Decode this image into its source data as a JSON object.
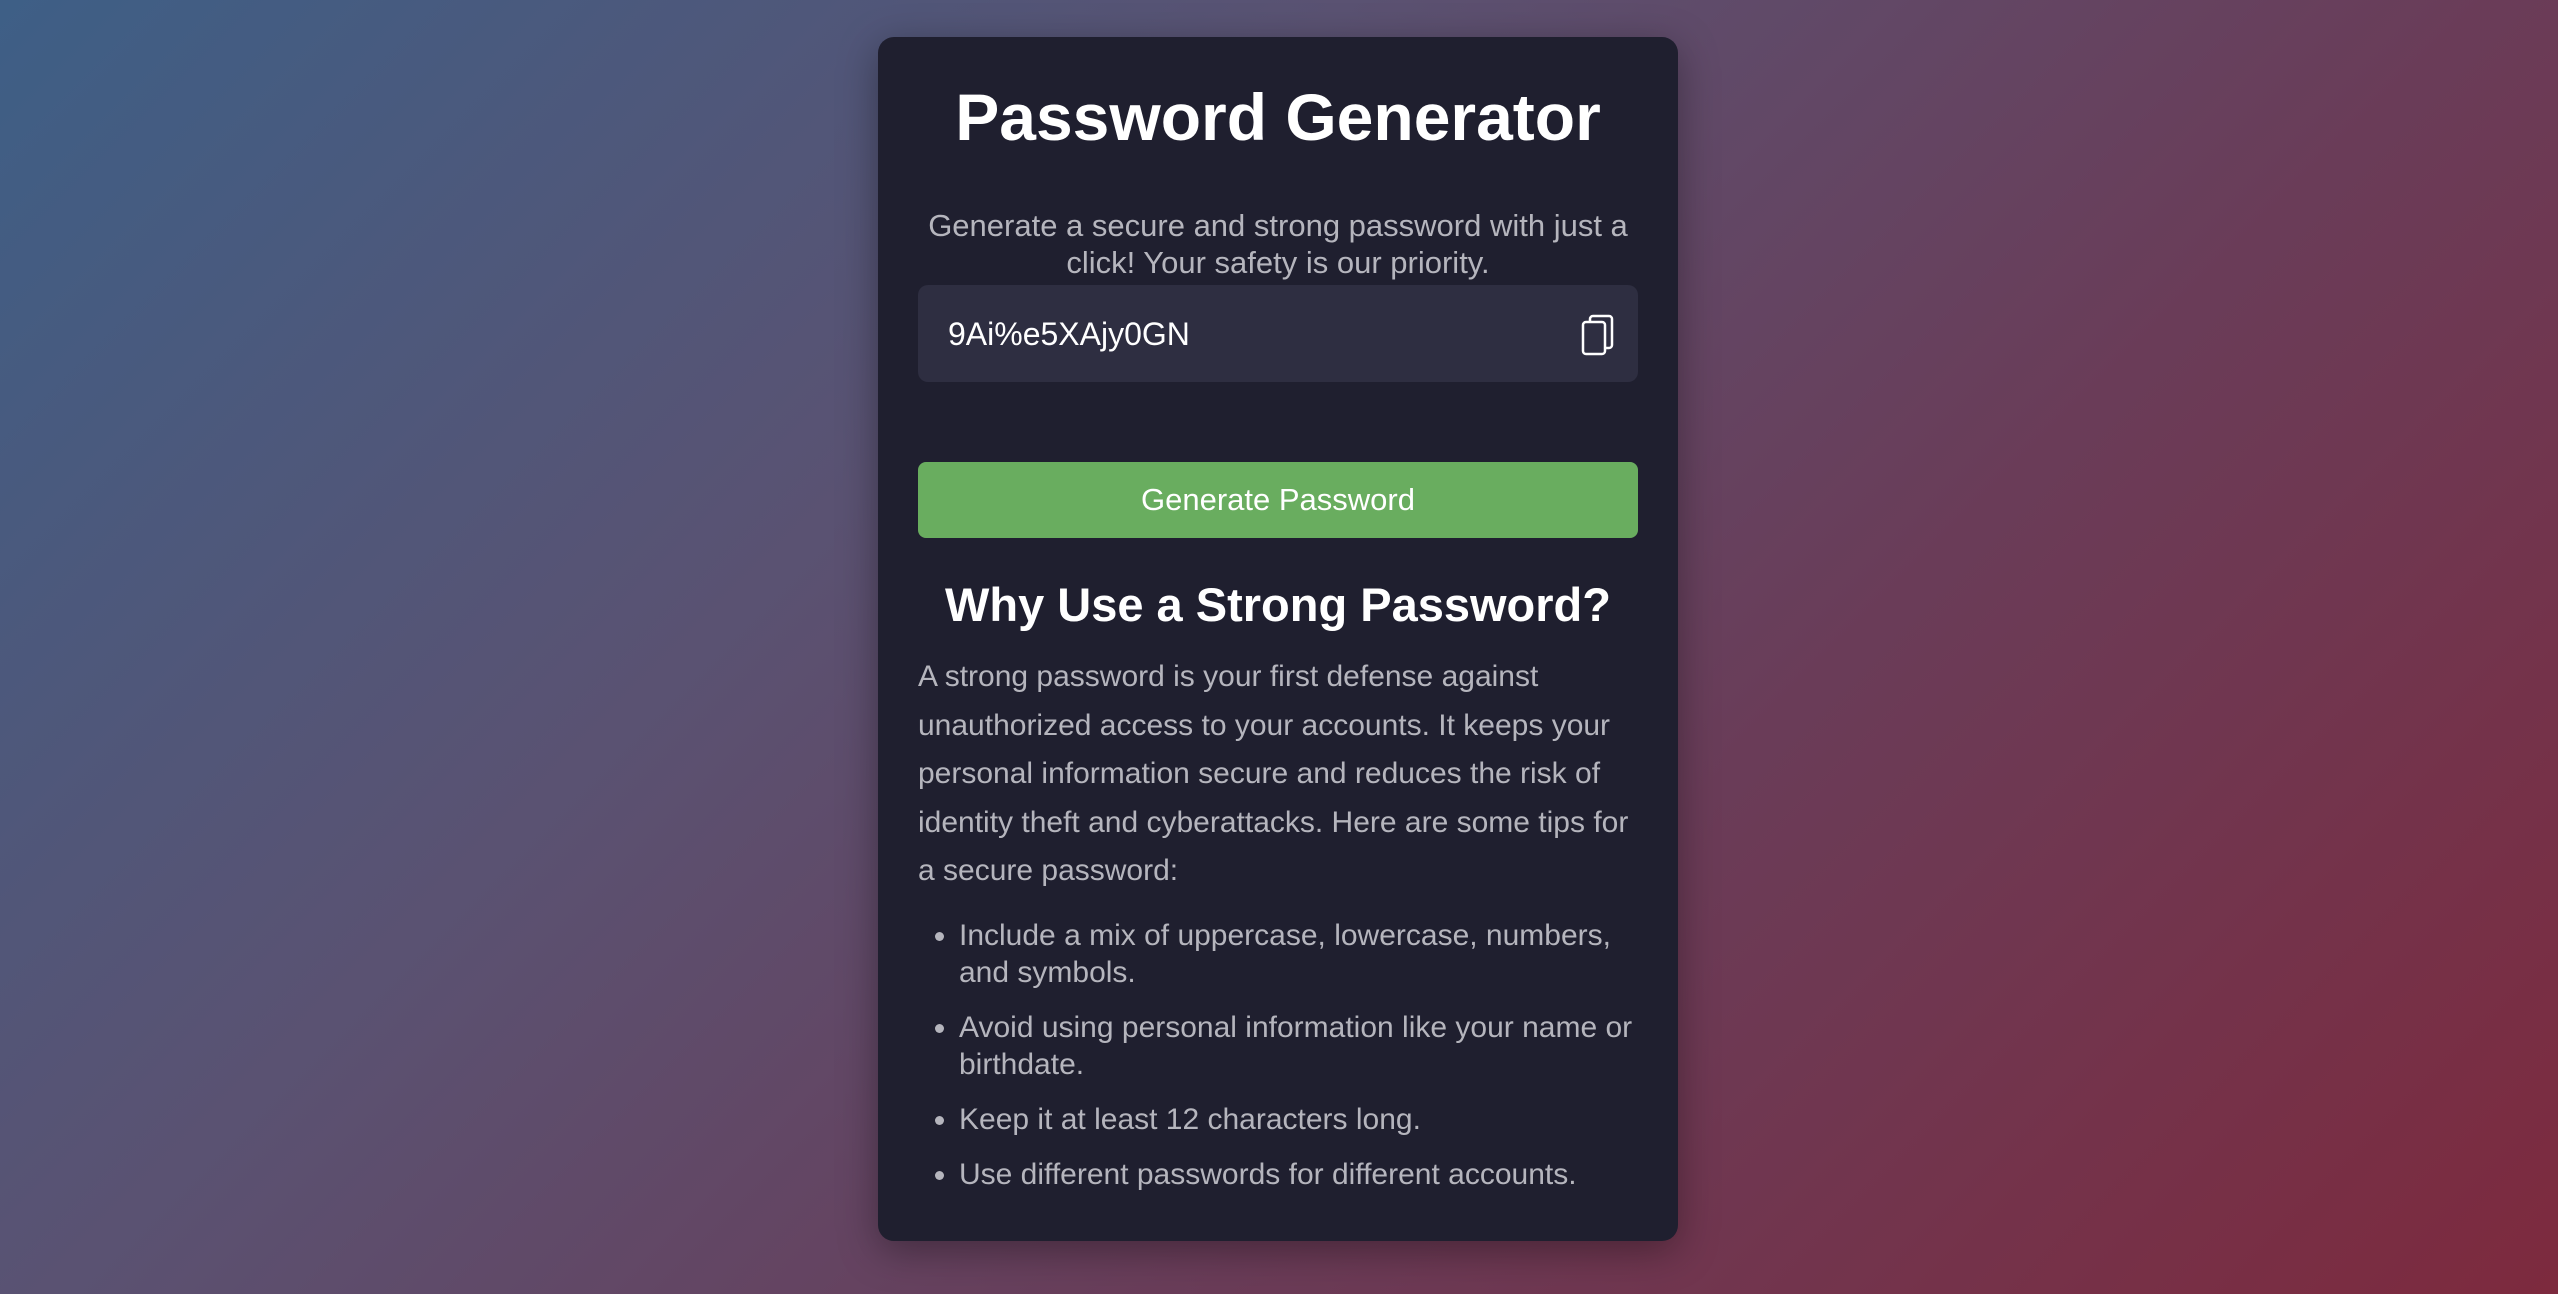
{
  "header": {
    "title": "Password Generator",
    "subtitle": "Generate a secure and strong password with just a click! Your safety is our priority."
  },
  "password": {
    "value": "9Ai%e5XAjy0GN",
    "copy_icon": "copy-icon"
  },
  "generate_button": {
    "label": "Generate Password"
  },
  "info": {
    "heading": "Why Use a Strong Password?",
    "paragraph": "A strong password is your first defense against unauthorized access to your accounts. It keeps your personal information secure and reduces the risk of identity theft and cyberattacks. Here are some tips for a secure password:",
    "tips": [
      "Include a mix of uppercase, lowercase, numbers, and symbols.",
      "Avoid using personal information like your name or birthdate.",
      "Keep it at least 12 characters long.",
      "Use different passwords for different accounts."
    ]
  },
  "colors": {
    "accent": "#69ad5f",
    "card": "#1f1f2f",
    "input": "#2e2e41"
  }
}
